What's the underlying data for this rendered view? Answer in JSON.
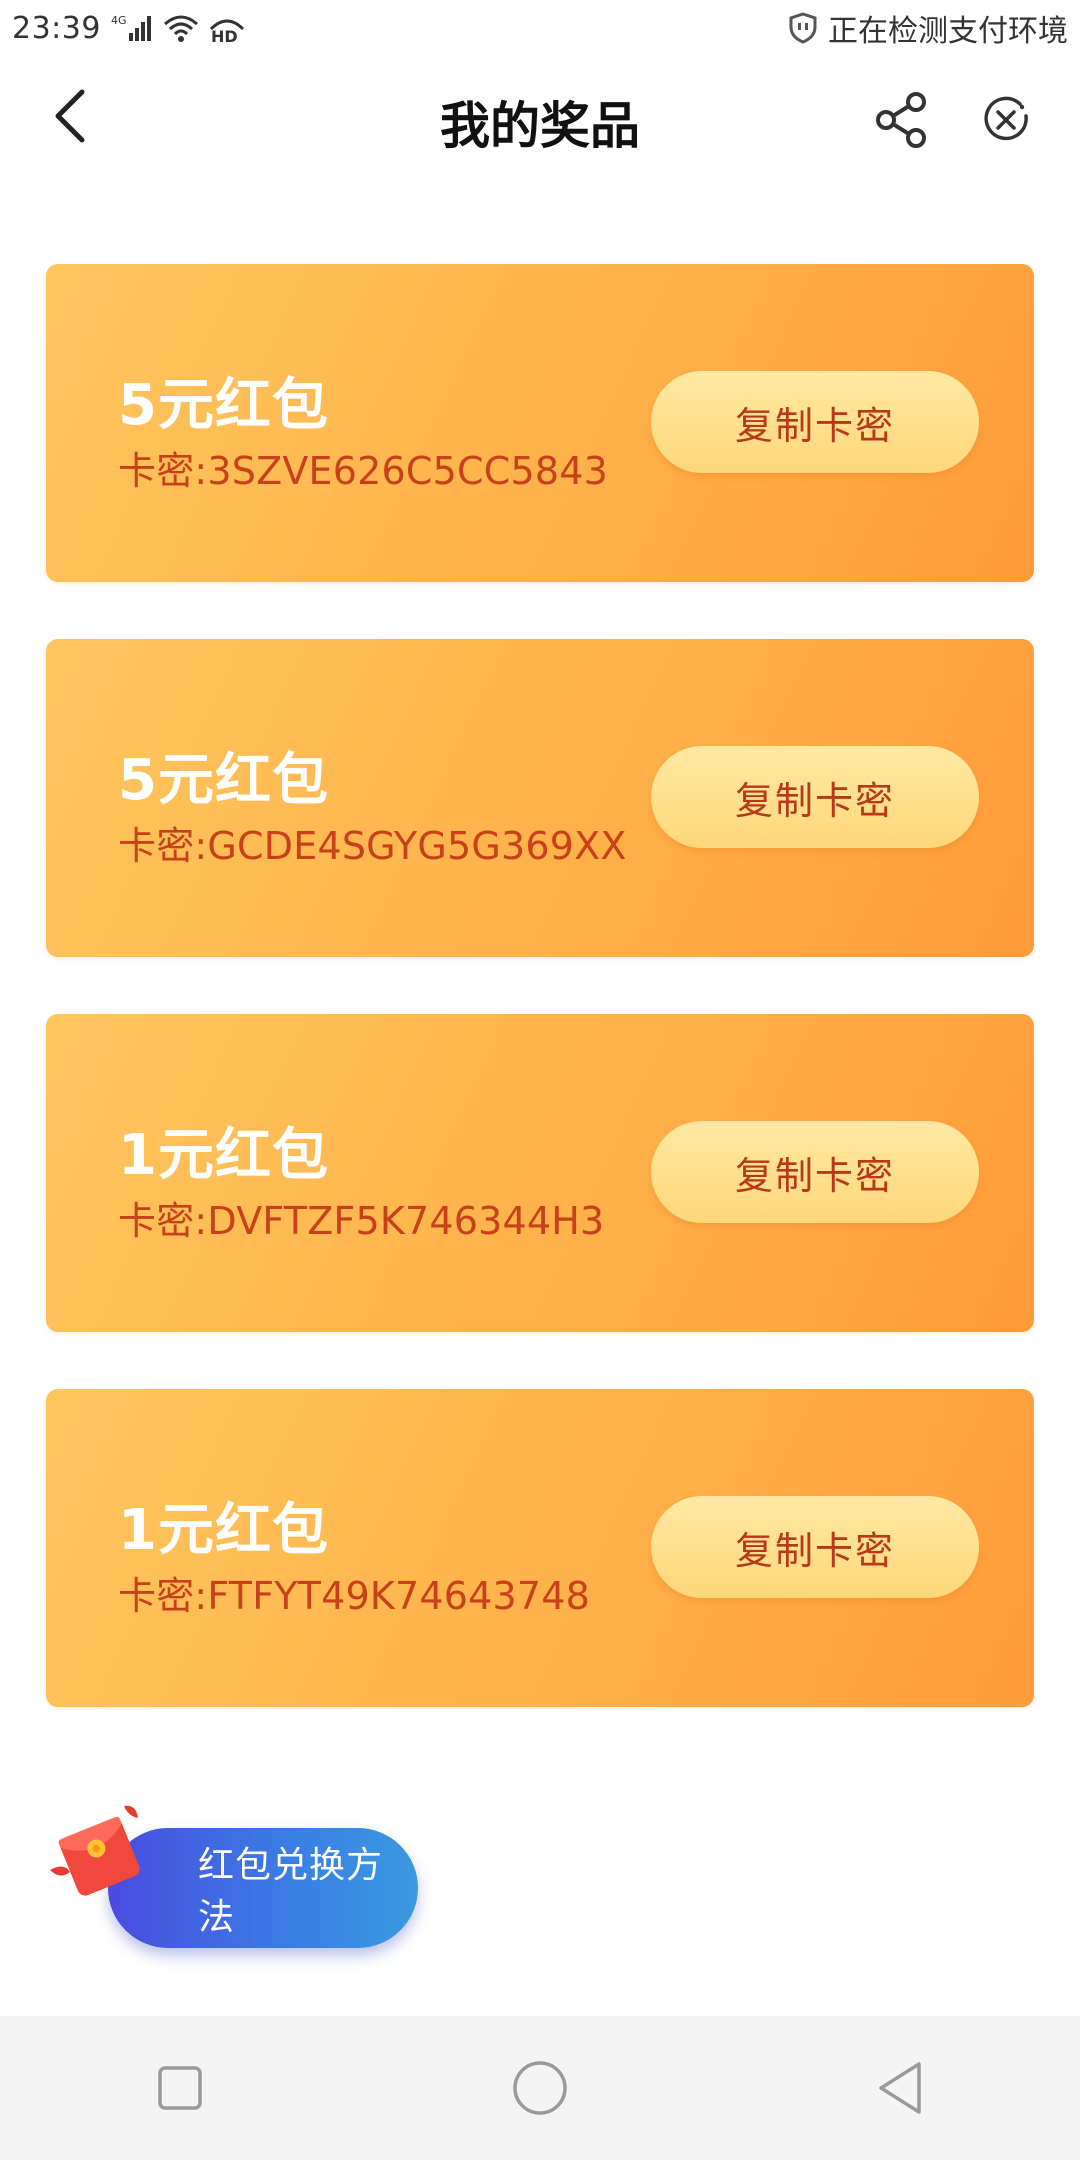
{
  "status_bar": {
    "time": "23:39",
    "network": "4G",
    "hd": "HD",
    "right_text": "正在检测支付环境",
    "icons": [
      "signal-icon",
      "wifi-icon",
      "hd-icon",
      "shield-icon"
    ]
  },
  "header": {
    "title": "我的奖品",
    "back_icon": "back-arrow-icon",
    "share_icon": "share-icon",
    "close_icon": "close-circle-icon"
  },
  "prizes": [
    {
      "name": "5元红包",
      "code": "卡密:3SZVE626C5CC5843",
      "button": "复制卡密"
    },
    {
      "name": "5元红包",
      "code": "卡密:GCDE4SGYG5G369XX",
      "button": "复制卡密"
    },
    {
      "name": "1元红包",
      "code": "卡密:DVFTZF5K746344H3",
      "button": "复制卡密"
    },
    {
      "name": "1元红包",
      "code": "卡密:FTFYT49K74643748",
      "button": "复制卡密"
    }
  ],
  "redeem": {
    "label": "红包兑换方法",
    "icon": "red-envelope-icon"
  },
  "nav": {
    "icons": [
      "recent-apps-icon",
      "home-icon",
      "back-triangle-icon"
    ]
  },
  "colors": {
    "card_gradient_start": "#ffc65e",
    "card_gradient_end": "#ff9b39",
    "code_text": "#c8411a",
    "copy_button": "#ffe09a",
    "redeem_gradient_start": "#4a4be0",
    "redeem_gradient_end": "#3a9ae0"
  }
}
